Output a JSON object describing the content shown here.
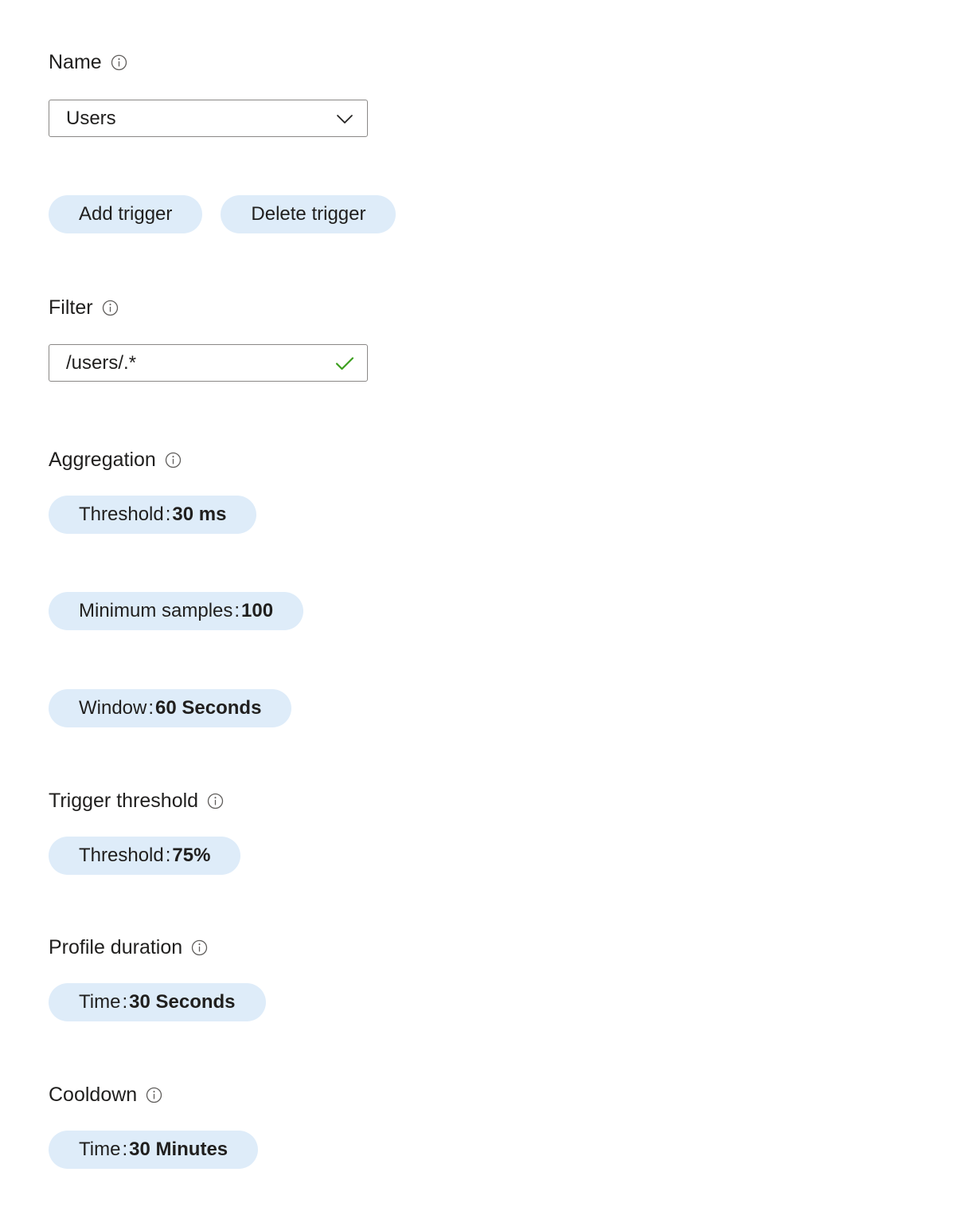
{
  "colors": {
    "pill_background": "#deecf9",
    "field_border": "#8a8886",
    "text": "#201f1e",
    "valid_check": "#3c9f1e",
    "info_icon": "#605e5c"
  },
  "name_section": {
    "label": "Name",
    "info_icon": "info-circle-icon",
    "dropdown": {
      "value": "Users",
      "chevron_icon": "chevron-down-icon"
    }
  },
  "trigger_buttons": {
    "add_label": "Add trigger",
    "delete_label": "Delete trigger"
  },
  "filter_section": {
    "label": "Filter",
    "info_icon": "info-circle-icon",
    "input": {
      "value": "/users/.*",
      "placeholder": "",
      "validation_icon": "checkmark-icon"
    }
  },
  "aggregation_section": {
    "label": "Aggregation",
    "info_icon": "info-circle-icon",
    "chips": [
      {
        "label": "Threshold",
        "separator": ":",
        "value": "30 ms"
      },
      {
        "label": "Minimum samples",
        "separator": ":",
        "value": "100"
      },
      {
        "label": "Window",
        "separator": ":",
        "value": "60 Seconds"
      }
    ]
  },
  "trigger_threshold_section": {
    "label": "Trigger threshold",
    "info_icon": "info-circle-icon",
    "chips": [
      {
        "label": "Threshold",
        "separator": ":",
        "value": "75%"
      }
    ]
  },
  "profile_duration_section": {
    "label": "Profile duration",
    "info_icon": "info-circle-icon",
    "chips": [
      {
        "label": "Time",
        "separator": ":",
        "value": "30 Seconds"
      }
    ]
  },
  "cooldown_section": {
    "label": "Cooldown",
    "info_icon": "info-circle-icon",
    "chips": [
      {
        "label": "Time",
        "separator": ":",
        "value": "30 Minutes"
      }
    ]
  }
}
